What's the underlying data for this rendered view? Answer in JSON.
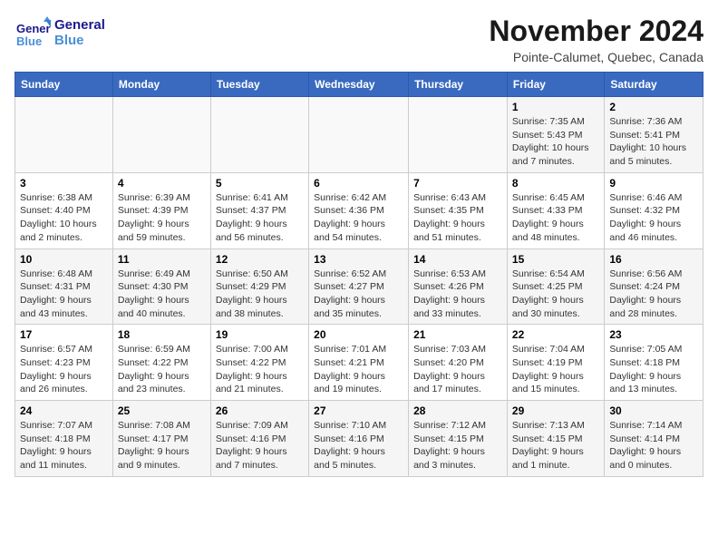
{
  "header": {
    "logo_general": "General",
    "logo_blue": "Blue",
    "title": "November 2024",
    "location": "Pointe-Calumet, Quebec, Canada"
  },
  "weekdays": [
    "Sunday",
    "Monday",
    "Tuesday",
    "Wednesday",
    "Thursday",
    "Friday",
    "Saturday"
  ],
  "weeks": [
    [
      {
        "day": "",
        "info": ""
      },
      {
        "day": "",
        "info": ""
      },
      {
        "day": "",
        "info": ""
      },
      {
        "day": "",
        "info": ""
      },
      {
        "day": "",
        "info": ""
      },
      {
        "day": "1",
        "info": "Sunrise: 7:35 AM\nSunset: 5:43 PM\nDaylight: 10 hours and 7 minutes."
      },
      {
        "day": "2",
        "info": "Sunrise: 7:36 AM\nSunset: 5:41 PM\nDaylight: 10 hours and 5 minutes."
      }
    ],
    [
      {
        "day": "3",
        "info": "Sunrise: 6:38 AM\nSunset: 4:40 PM\nDaylight: 10 hours and 2 minutes."
      },
      {
        "day": "4",
        "info": "Sunrise: 6:39 AM\nSunset: 4:39 PM\nDaylight: 9 hours and 59 minutes."
      },
      {
        "day": "5",
        "info": "Sunrise: 6:41 AM\nSunset: 4:37 PM\nDaylight: 9 hours and 56 minutes."
      },
      {
        "day": "6",
        "info": "Sunrise: 6:42 AM\nSunset: 4:36 PM\nDaylight: 9 hours and 54 minutes."
      },
      {
        "day": "7",
        "info": "Sunrise: 6:43 AM\nSunset: 4:35 PM\nDaylight: 9 hours and 51 minutes."
      },
      {
        "day": "8",
        "info": "Sunrise: 6:45 AM\nSunset: 4:33 PM\nDaylight: 9 hours and 48 minutes."
      },
      {
        "day": "9",
        "info": "Sunrise: 6:46 AM\nSunset: 4:32 PM\nDaylight: 9 hours and 46 minutes."
      }
    ],
    [
      {
        "day": "10",
        "info": "Sunrise: 6:48 AM\nSunset: 4:31 PM\nDaylight: 9 hours and 43 minutes."
      },
      {
        "day": "11",
        "info": "Sunrise: 6:49 AM\nSunset: 4:30 PM\nDaylight: 9 hours and 40 minutes."
      },
      {
        "day": "12",
        "info": "Sunrise: 6:50 AM\nSunset: 4:29 PM\nDaylight: 9 hours and 38 minutes."
      },
      {
        "day": "13",
        "info": "Sunrise: 6:52 AM\nSunset: 4:27 PM\nDaylight: 9 hours and 35 minutes."
      },
      {
        "day": "14",
        "info": "Sunrise: 6:53 AM\nSunset: 4:26 PM\nDaylight: 9 hours and 33 minutes."
      },
      {
        "day": "15",
        "info": "Sunrise: 6:54 AM\nSunset: 4:25 PM\nDaylight: 9 hours and 30 minutes."
      },
      {
        "day": "16",
        "info": "Sunrise: 6:56 AM\nSunset: 4:24 PM\nDaylight: 9 hours and 28 minutes."
      }
    ],
    [
      {
        "day": "17",
        "info": "Sunrise: 6:57 AM\nSunset: 4:23 PM\nDaylight: 9 hours and 26 minutes."
      },
      {
        "day": "18",
        "info": "Sunrise: 6:59 AM\nSunset: 4:22 PM\nDaylight: 9 hours and 23 minutes."
      },
      {
        "day": "19",
        "info": "Sunrise: 7:00 AM\nSunset: 4:22 PM\nDaylight: 9 hours and 21 minutes."
      },
      {
        "day": "20",
        "info": "Sunrise: 7:01 AM\nSunset: 4:21 PM\nDaylight: 9 hours and 19 minutes."
      },
      {
        "day": "21",
        "info": "Sunrise: 7:03 AM\nSunset: 4:20 PM\nDaylight: 9 hours and 17 minutes."
      },
      {
        "day": "22",
        "info": "Sunrise: 7:04 AM\nSunset: 4:19 PM\nDaylight: 9 hours and 15 minutes."
      },
      {
        "day": "23",
        "info": "Sunrise: 7:05 AM\nSunset: 4:18 PM\nDaylight: 9 hours and 13 minutes."
      }
    ],
    [
      {
        "day": "24",
        "info": "Sunrise: 7:07 AM\nSunset: 4:18 PM\nDaylight: 9 hours and 11 minutes."
      },
      {
        "day": "25",
        "info": "Sunrise: 7:08 AM\nSunset: 4:17 PM\nDaylight: 9 hours and 9 minutes."
      },
      {
        "day": "26",
        "info": "Sunrise: 7:09 AM\nSunset: 4:16 PM\nDaylight: 9 hours and 7 minutes."
      },
      {
        "day": "27",
        "info": "Sunrise: 7:10 AM\nSunset: 4:16 PM\nDaylight: 9 hours and 5 minutes."
      },
      {
        "day": "28",
        "info": "Sunrise: 7:12 AM\nSunset: 4:15 PM\nDaylight: 9 hours and 3 minutes."
      },
      {
        "day": "29",
        "info": "Sunrise: 7:13 AM\nSunset: 4:15 PM\nDaylight: 9 hours and 1 minute."
      },
      {
        "day": "30",
        "info": "Sunrise: 7:14 AM\nSunset: 4:14 PM\nDaylight: 9 hours and 0 minutes."
      }
    ]
  ]
}
